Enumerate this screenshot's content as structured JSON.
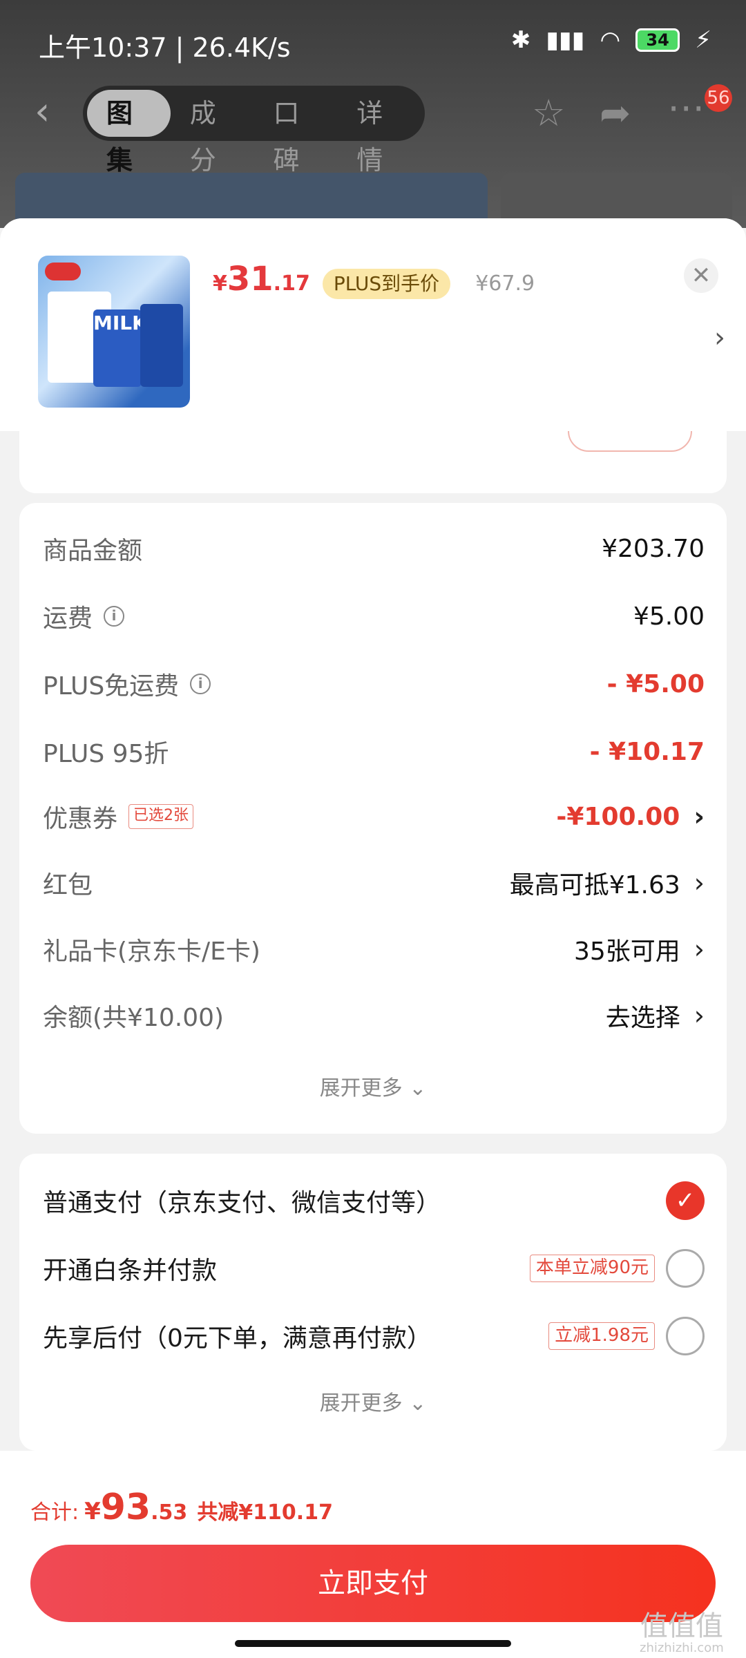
{
  "status_bar": {
    "time": "上午10:37 | 26.4K/s",
    "battery": "34"
  },
  "nav": {
    "tabs": [
      "图集",
      "成分",
      "口碑",
      "详情"
    ],
    "badge": "56"
  },
  "product": {
    "price_yen": "¥",
    "price_int": "31",
    "price_dec": ".17",
    "plus_tag": "PLUS到手价",
    "original_price": "¥67.9",
    "image_text": "MILK"
  },
  "fees": {
    "rows": [
      {
        "label": "商品金额",
        "value": "¥203.70"
      },
      {
        "label": "运费",
        "value": "¥5.00"
      },
      {
        "label": "PLUS免运费",
        "value": "- ¥5.00"
      },
      {
        "label": "PLUS 95折",
        "value": "- ¥10.17"
      },
      {
        "label": "优惠券",
        "tag": "已选2张",
        "value": "-¥100.00"
      },
      {
        "label": "红包",
        "value": "最高可抵¥1.63"
      },
      {
        "label": "礼品卡(京东卡/E卡)",
        "value": "35张可用"
      },
      {
        "label": "余额(共¥10.00)",
        "value": "去选择"
      }
    ],
    "expand": "展开更多 ⌄"
  },
  "payment": {
    "options": [
      {
        "label": "普通支付（京东支付、微信支付等）",
        "selected": true
      },
      {
        "label": "开通白条并付款",
        "tag": "本单立减90元",
        "selected": false
      },
      {
        "label": "先享后付（0元下单，满意再付款）",
        "tag": "立减1.98元",
        "selected": false
      }
    ],
    "expand": "展开更多 ⌄"
  },
  "footer": {
    "total_label": "合计:",
    "total_yen": "¥",
    "total_int": "93",
    "total_dec": ".53",
    "saved": "共减¥110.17",
    "pay_button": "立即支付"
  },
  "watermark": {
    "main": "值值值",
    "sub": "zhizhizhi.com"
  },
  "colors": {
    "accent": "#e33b2f",
    "plus_tag_bg": "#fbe7a8",
    "pay_button": "#f5321f"
  }
}
